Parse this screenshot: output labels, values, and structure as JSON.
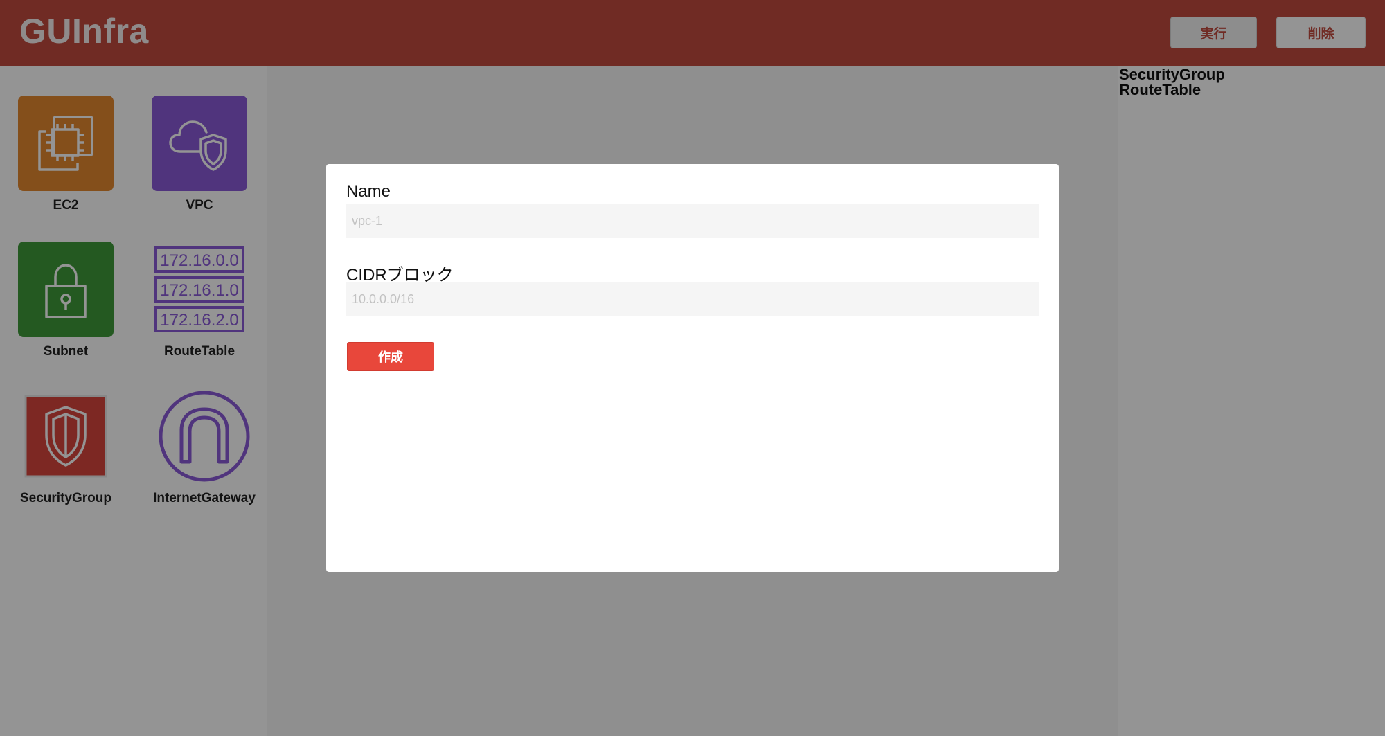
{
  "app": {
    "title": "GUInfra"
  },
  "header": {
    "run_label": "実行",
    "delete_label": "削除"
  },
  "sidebar": {
    "items": [
      {
        "label": "EC2",
        "icon": "ec2-chip-icon",
        "color": "#e4882f"
      },
      {
        "label": "VPC",
        "icon": "vpc-cloud-shield-icon",
        "color": "#8a5ad8"
      },
      {
        "label": "Subnet",
        "icon": "subnet-lock-icon",
        "color": "#3f9a3a"
      },
      {
        "label": "RouteTable",
        "icon": "route-table-icon",
        "color": "#8a5ad8",
        "entries": [
          "172.16.0.0",
          "172.16.1.0",
          "172.16.2.0"
        ]
      },
      {
        "label": "SecurityGroup",
        "icon": "security-group-shield-icon",
        "color": "#d8453d"
      },
      {
        "label": "InternetGateway",
        "icon": "internet-gateway-arch-icon",
        "color": "#8a5ad8"
      }
    ]
  },
  "right_panel": {
    "items": [
      "SecurityGroup",
      "RouteTable"
    ]
  },
  "modal": {
    "name_label": "Name",
    "name_placeholder": "vpc-1",
    "cidr_label": "CIDRブロック",
    "cidr_placeholder": "10.0.0.0/16",
    "create_label": "作成"
  }
}
